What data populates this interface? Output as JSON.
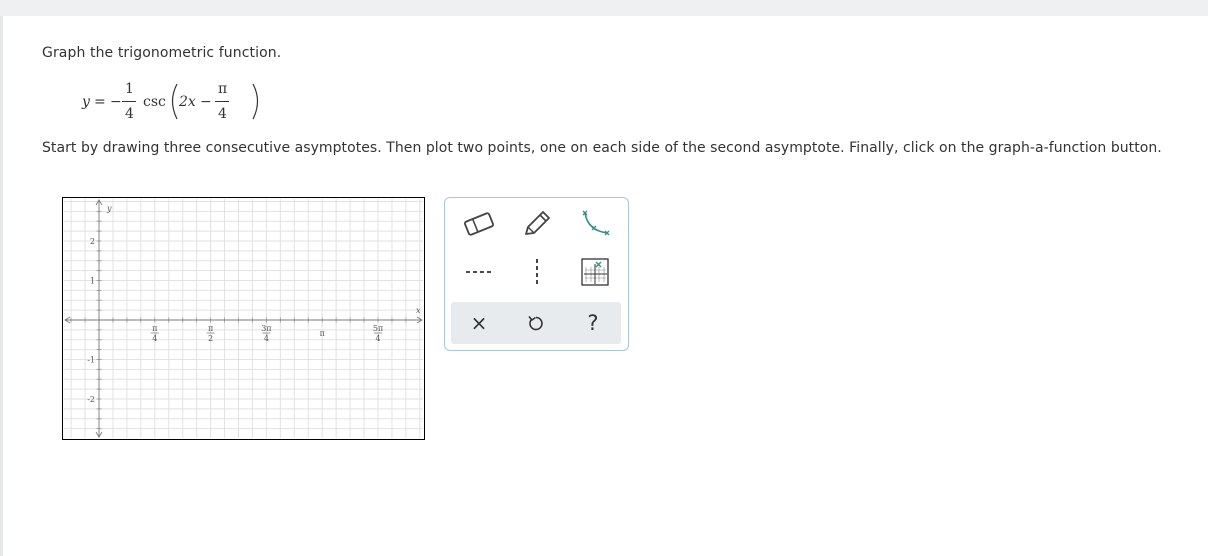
{
  "instruction": "Graph the trigonometric function.",
  "equation": {
    "lhs": "y",
    "equals": "=",
    "minus": "−",
    "frac_num": "1",
    "frac_den": "4",
    "func": "csc",
    "var": "2x",
    "inner_minus": "−",
    "pi": "π",
    "pi_den": "4"
  },
  "directions": "Start by drawing three consecutive asymptotes. Then plot two points, one on each side of the second asymptote. Finally, click on the graph-a-function button.",
  "graph": {
    "x_axis_label": "x",
    "y_axis_label": "y",
    "x_ticks": [
      {
        "type": "frac",
        "num": "π",
        "den": "4"
      },
      {
        "type": "frac",
        "num": "π",
        "den": "2"
      },
      {
        "type": "frac",
        "num": "3π",
        "den": "4"
      },
      {
        "type": "single",
        "text": "π"
      },
      {
        "type": "frac",
        "num": "5π",
        "den": "4"
      }
    ],
    "y_ticks": [
      "2",
      "1",
      "-1",
      "-2"
    ]
  },
  "toolbox": {
    "tools": [
      "eraser-icon",
      "pencil-icon",
      "function-curve-icon",
      "horizontal-asymptote-icon",
      "vertical-asymptote-icon",
      "graph-function-icon"
    ],
    "actions": {
      "clear": "×",
      "help": "?"
    },
    "colors": {
      "accent": "#2f8f8a",
      "border": "#aac6de",
      "action_bg": "#e7ebee"
    }
  }
}
